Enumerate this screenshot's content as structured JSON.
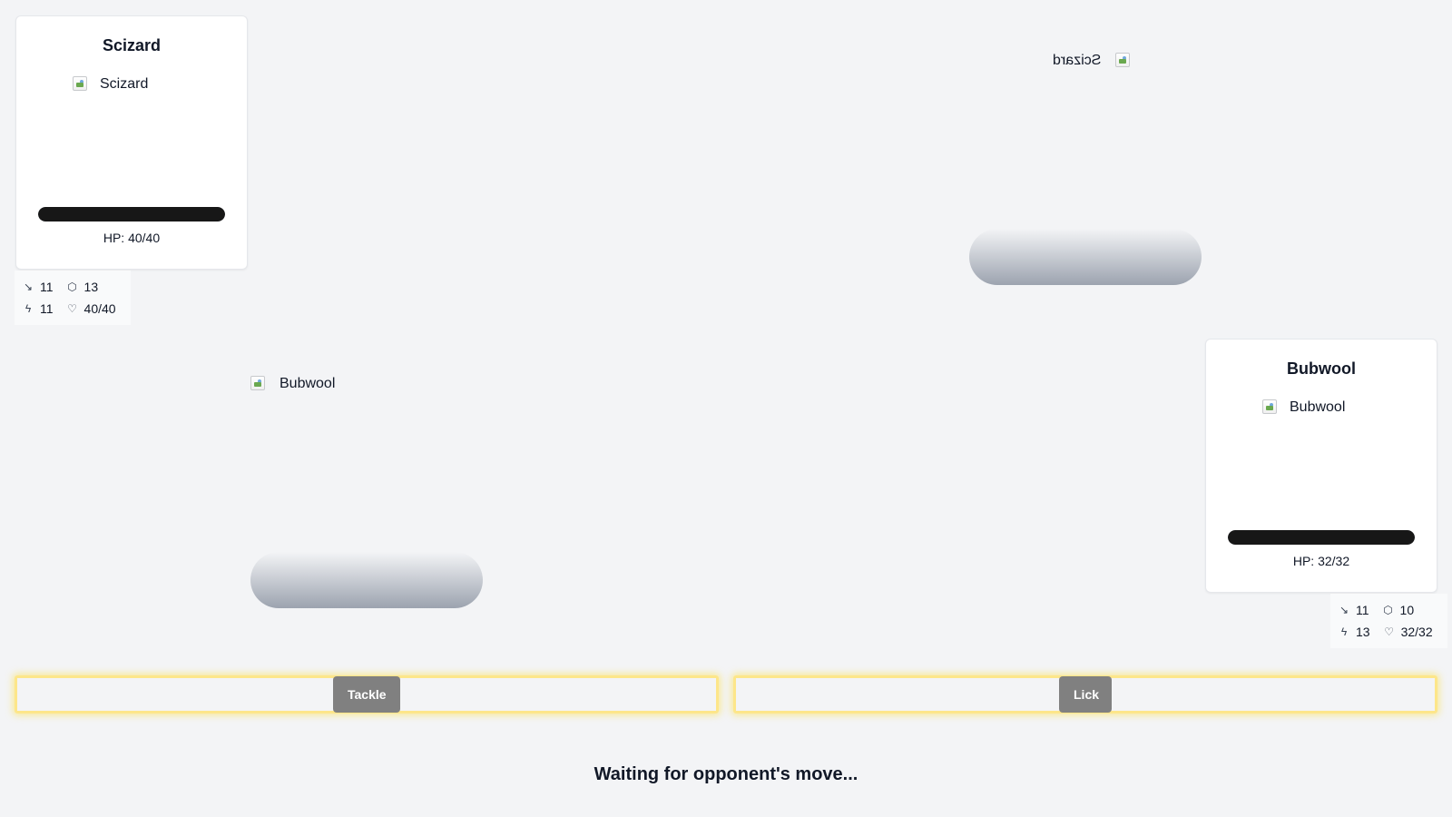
{
  "opponent": {
    "name": "Scizard",
    "image_alt": "Scizard",
    "hp_text": "HP: 40/40",
    "hp_fraction": 1.0,
    "stats": {
      "attack": "11",
      "defense": "13",
      "speed": "11",
      "hp": "40/40"
    },
    "sprite_label": "Scizard"
  },
  "player": {
    "name": "Bubwool",
    "image_alt": "Bubwool",
    "hp_text": "HP: 32/32",
    "hp_fraction": 1.0,
    "stats": {
      "attack": "11",
      "defense": "10",
      "speed": "13",
      "hp": "32/32"
    },
    "sprite_label": "Bubwool"
  },
  "moves": [
    "Tackle",
    "Lick"
  ],
  "status_text": "Waiting for opponent's move...",
  "colors": {
    "background": "#f3f4f6",
    "hp_fill": "#171717",
    "move_button": "#808080",
    "move_glow": "#fde68a"
  },
  "icons": {
    "attack": "sword-icon",
    "defense": "shield-icon",
    "speed": "lightning-icon",
    "hp": "heart-icon"
  }
}
